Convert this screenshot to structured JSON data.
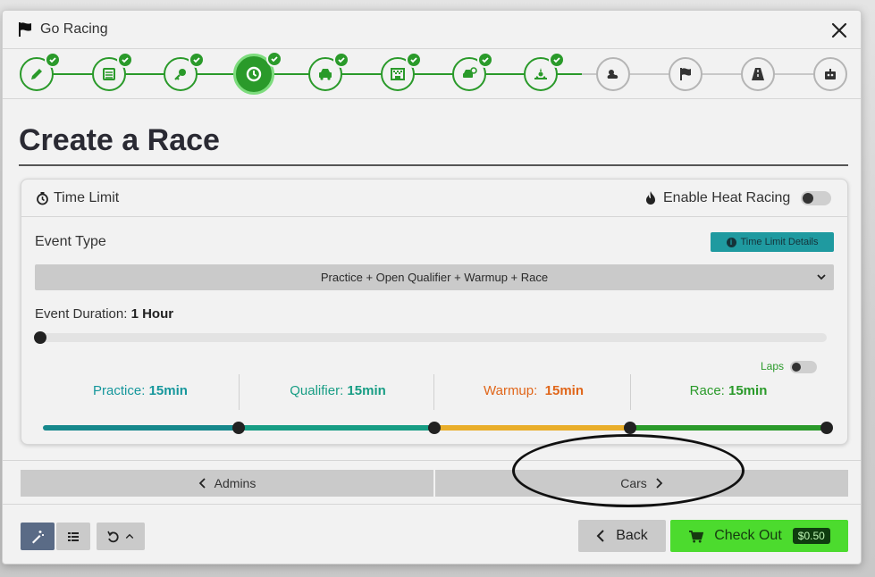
{
  "window": {
    "title": "Go Racing"
  },
  "steps": [
    {
      "icon": "pencil-icon",
      "state": "done"
    },
    {
      "icon": "list-icon",
      "state": "done"
    },
    {
      "icon": "key-icon",
      "state": "done"
    },
    {
      "icon": "clock-icon",
      "state": "active"
    },
    {
      "icon": "cars-icon",
      "state": "done"
    },
    {
      "icon": "track-icon",
      "state": "done"
    },
    {
      "icon": "car-settings-icon",
      "state": "done"
    },
    {
      "icon": "session-icon",
      "state": "done"
    },
    {
      "icon": "weather-icon",
      "state": "pending"
    },
    {
      "icon": "flag-icon",
      "state": "pending"
    },
    {
      "icon": "road-icon",
      "state": "pending"
    },
    {
      "icon": "robot-icon",
      "state": "pending"
    }
  ],
  "page": {
    "title": "Create a Race"
  },
  "card": {
    "title": "Time Limit",
    "heat_racing_label": "Enable Heat Racing",
    "heat_racing_enabled": false,
    "event_type_label": "Event Type",
    "details_button": "Time Limit Details",
    "event_type_value": "Practice + Open Qualifier + Warmup + Race",
    "duration_prefix": "Event Duration:",
    "duration_value": "1 Hour",
    "duration_slider_fraction": 0,
    "laps_label": "Laps",
    "laps_enabled": false,
    "segments": [
      {
        "label": "Practice:",
        "value": "15min",
        "color": "#16979c"
      },
      {
        "label": "Qualifier:",
        "value": "15min",
        "color": "#179d84"
      },
      {
        "label": "Warmup:",
        "value": "15min",
        "color": "#e0661a"
      },
      {
        "label": "Race:",
        "value": "15min",
        "color": "#2a9a2a"
      }
    ],
    "bar_colors": [
      "#16888c",
      "#179d84",
      "#e9ae2a",
      "#2a9a2a"
    ]
  },
  "nav": {
    "prev_label": "Admins",
    "next_label": "Cars"
  },
  "footer": {
    "back_label": "Back",
    "checkout_label": "Check Out",
    "price": "$0.50"
  },
  "colors": {
    "accent": "#2a9a2a",
    "checkout": "#4cdb2e",
    "teal": "#1f9aa0"
  }
}
